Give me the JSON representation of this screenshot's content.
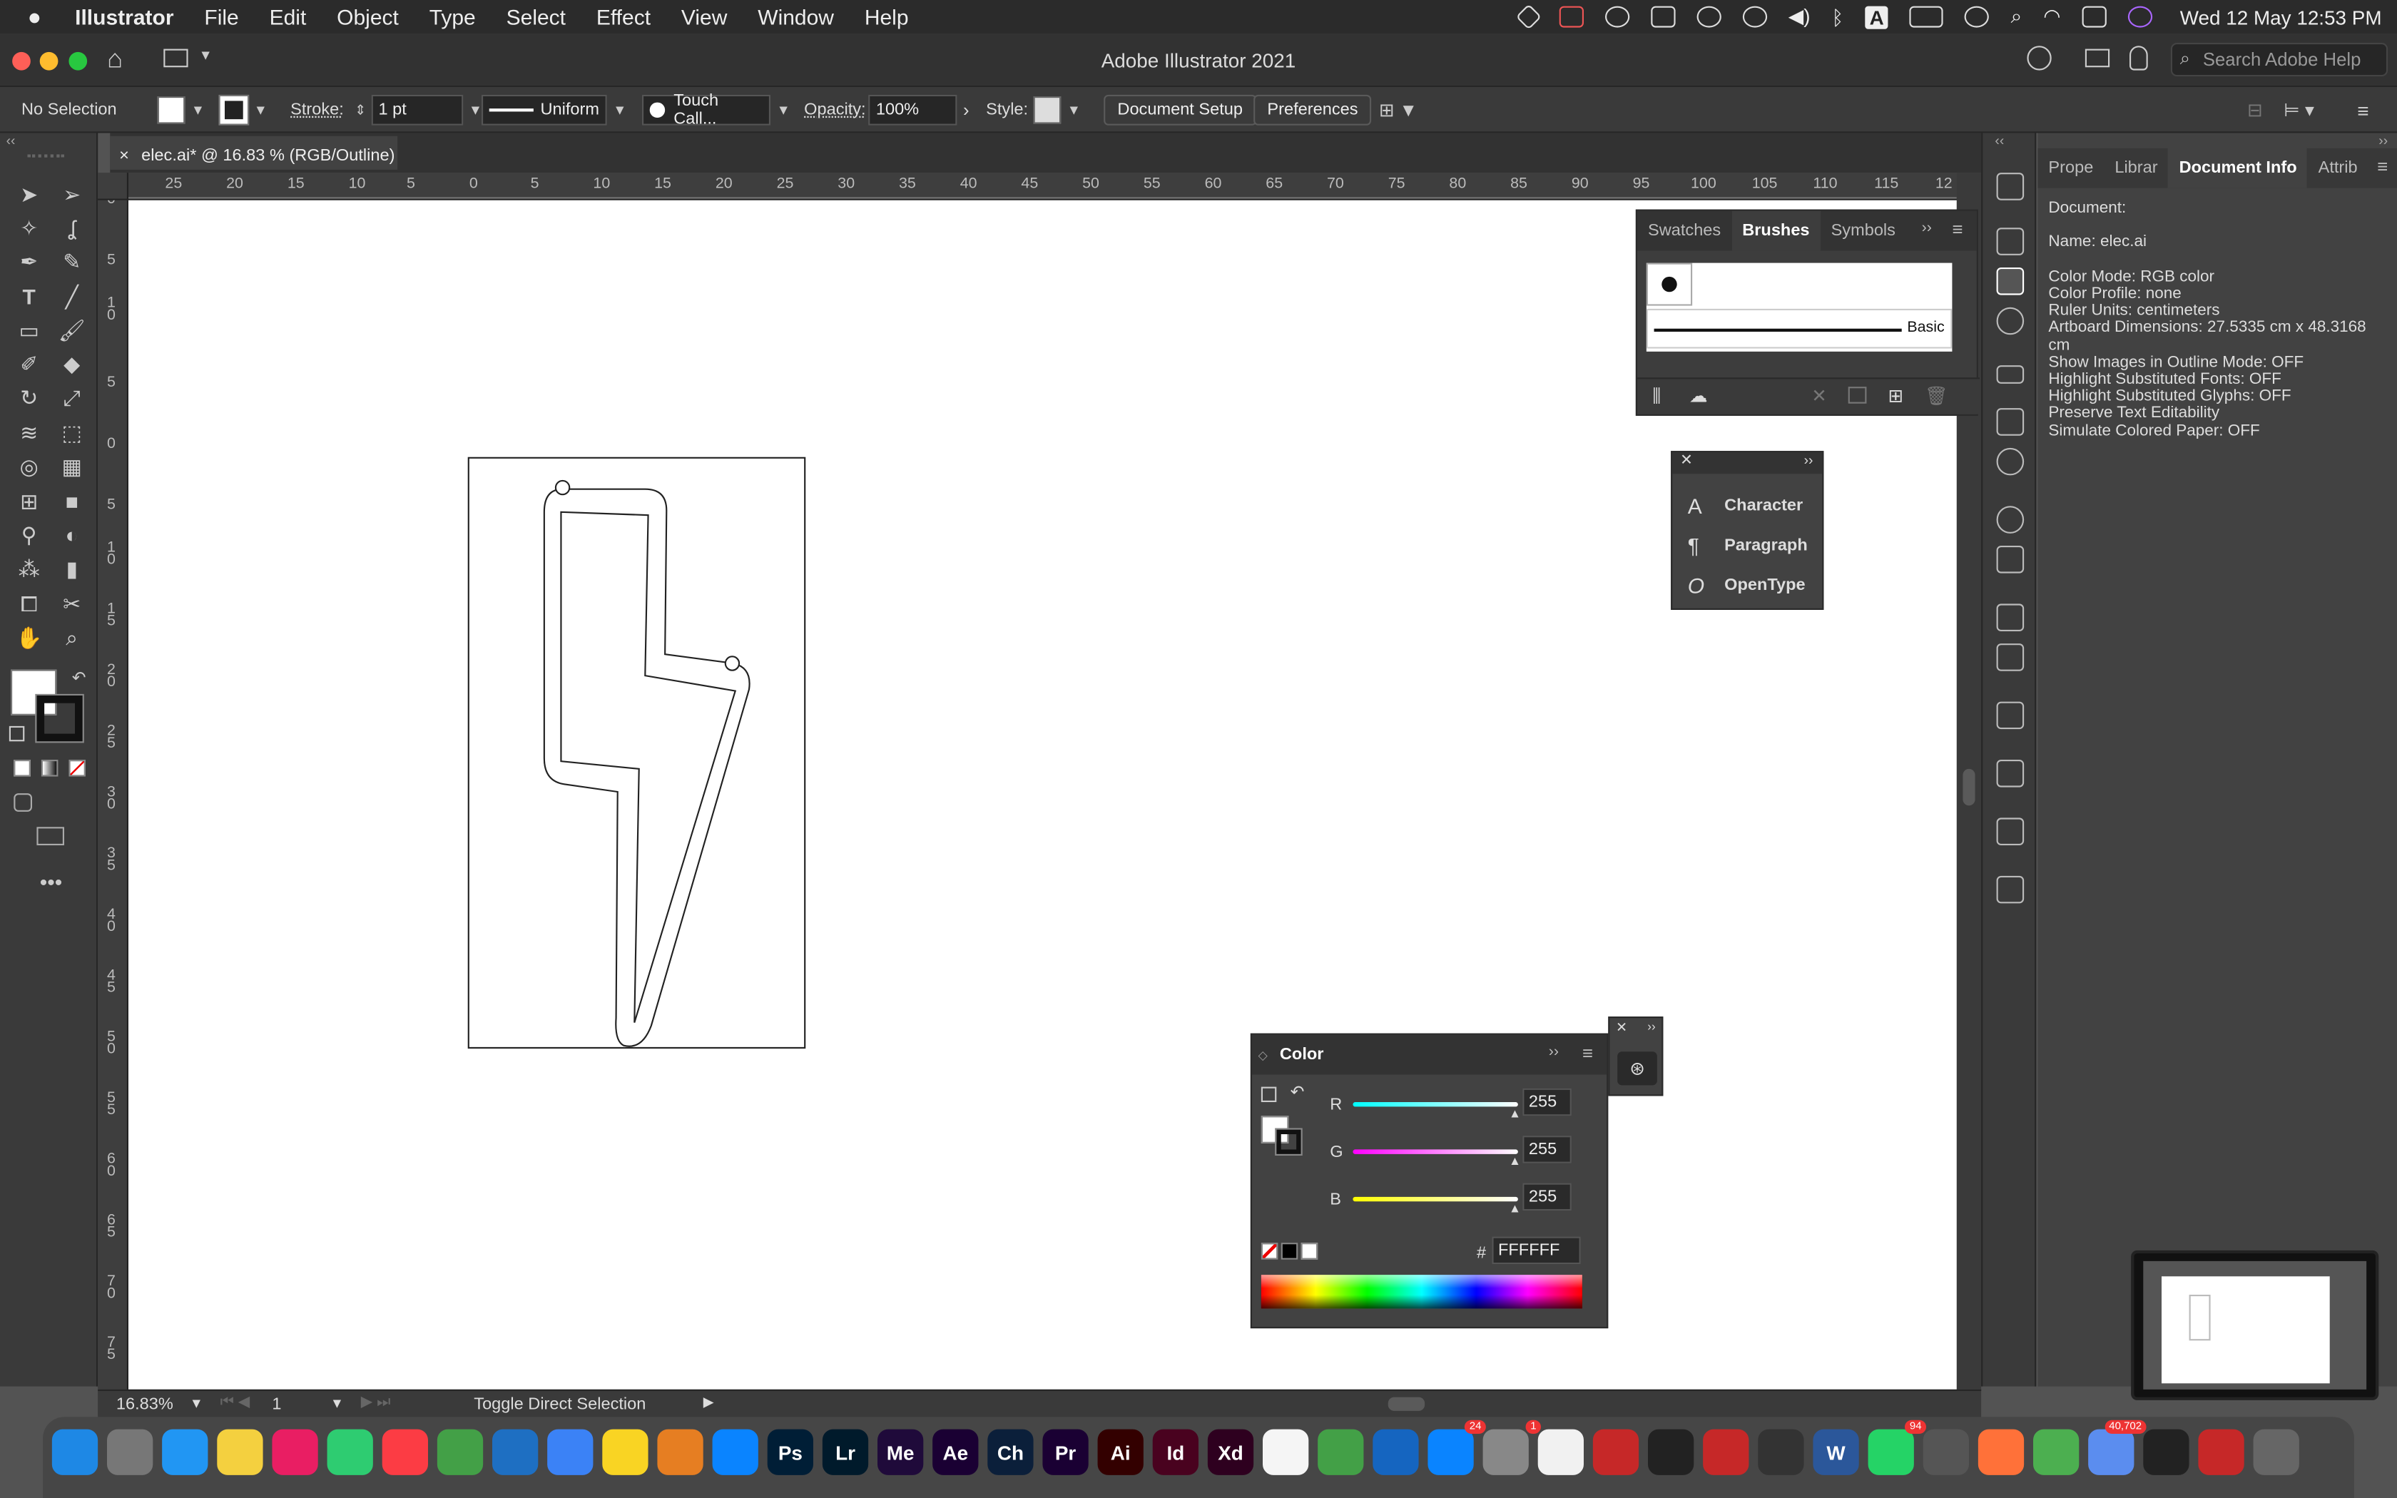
{
  "menubar": {
    "app": "Illustrator",
    "items": [
      "File",
      "Edit",
      "Object",
      "Type",
      "Select",
      "Effect",
      "View",
      "Window",
      "Help"
    ],
    "clock": "Wed 12 May  12:53 PM"
  },
  "titlebar": {
    "title": "Adobe Illustrator 2021",
    "search_placeholder": "Search Adobe Help"
  },
  "control": {
    "selection": "No Selection",
    "stroke_label": "Stroke:",
    "stroke_value": "1 pt",
    "profile": "Uniform",
    "brush": "Touch Call...",
    "opacity_label": "Opacity:",
    "opacity_value": "100%",
    "style_label": "Style:",
    "document_setup": "Document Setup",
    "preferences": "Preferences"
  },
  "doc_tab": {
    "close": "×",
    "label": "elec.ai* @ 16.83 % (RGB/Outline)"
  },
  "ruler_top": [
    "25",
    "20",
    "15",
    "10",
    "5",
    "0",
    "5",
    "10",
    "15",
    "20",
    "25",
    "30",
    "35",
    "40",
    "45",
    "50",
    "55",
    "60",
    "65",
    "70",
    "75",
    "80",
    "85",
    "90",
    "95",
    "100",
    "105",
    "110",
    "115",
    "12"
  ],
  "ruler_left": [
    "0",
    "5",
    "1 0",
    "5",
    "0",
    "5",
    "1 0",
    "1 5",
    "2 0",
    "2 5",
    "3 0",
    "3 5",
    "4 0",
    "4 5",
    "5 0",
    "5 5",
    "6 0",
    "6 5",
    "7 0",
    "7 5"
  ],
  "brushes_panel": {
    "tabs": [
      "Swatches",
      "Brushes",
      "Symbols"
    ],
    "active": "Brushes",
    "basic_label": "Basic"
  },
  "type_panel": {
    "items": [
      {
        "icon": "A",
        "label": "Character"
      },
      {
        "icon": "¶",
        "label": "Paragraph"
      },
      {
        "icon": "O",
        "label": "OpenType"
      }
    ]
  },
  "color_panel": {
    "title": "Color",
    "r_label": "R",
    "r_value": "255",
    "g_label": "G",
    "g_value": "255",
    "b_label": "B",
    "b_value": "255",
    "hex_label": "#",
    "hex_value": "FFFFFF"
  },
  "right_panel": {
    "tabs": [
      "Prope",
      "Librar",
      "Document Info",
      "Attrib"
    ],
    "active": "Document Info",
    "lines": [
      "Document:",
      "",
      "Name: elec.ai",
      "",
      "Color Mode: RGB color",
      "Color Profile: none",
      "Ruler Units: centimeters",
      "Artboard Dimensions: 27.5335 cm x 48.3168",
      "cm",
      "Show Images in Outline Mode: OFF",
      "Highlight Substituted Fonts: OFF",
      "Highlight Substituted Glyphs: OFF",
      "Preserve Text Editability",
      "Simulate Colored Paper: OFF"
    ]
  },
  "status": {
    "zoom": "16.83%",
    "artboard": "1",
    "tool_hint": "Toggle Direct Selection"
  },
  "dock": {
    "apps": [
      {
        "label": "",
        "color": "#1e88e5"
      },
      {
        "label": "",
        "color": "#777"
      },
      {
        "label": "",
        "color": "#2196f3"
      },
      {
        "label": "",
        "color": "#f4d03f"
      },
      {
        "label": "",
        "color": "#e91e63"
      },
      {
        "label": "",
        "color": "#2ecc71"
      },
      {
        "label": "",
        "color": "#fc3c44"
      },
      {
        "label": "",
        "color": "#43a047"
      },
      {
        "label": "",
        "color": "#1e6fc2"
      },
      {
        "label": "",
        "color": "#3b82f6"
      },
      {
        "label": "",
        "color": "#f9d423"
      },
      {
        "label": "",
        "color": "#e67e22"
      },
      {
        "label": "",
        "color": "#0a84ff"
      },
      {
        "label": "Ps",
        "color": "#001e36"
      },
      {
        "label": "Lr",
        "color": "#001a2b"
      },
      {
        "label": "Me",
        "color": "#1f0a3a"
      },
      {
        "label": "Ae",
        "color": "#1a0033"
      },
      {
        "label": "Ch",
        "color": "#0b1f3a"
      },
      {
        "label": "Pr",
        "color": "#1a0033"
      },
      {
        "label": "Ai",
        "color": "#330000"
      },
      {
        "label": "Id",
        "color": "#49021f"
      },
      {
        "label": "Xd",
        "color": "#2e001f"
      },
      {
        "label": "",
        "color": "#f5f5f5"
      },
      {
        "label": "",
        "color": "#43a047"
      },
      {
        "label": "",
        "color": "#1565c0"
      },
      {
        "label": "",
        "color": "#0a84ff",
        "badge": "24"
      },
      {
        "label": "",
        "color": "#888",
        "badge": "1"
      },
      {
        "label": "",
        "color": "#f1f1f1"
      },
      {
        "label": "",
        "color": "#c62828"
      },
      {
        "label": "",
        "color": "#222"
      },
      {
        "label": "",
        "color": "#c62828"
      },
      {
        "label": "",
        "color": "#333"
      },
      {
        "label": "W",
        "color": "#2b579a"
      },
      {
        "label": "",
        "color": "#25d366",
        "badge": "94"
      },
      {
        "label": "",
        "color": "#555"
      },
      {
        "label": "",
        "color": "#ff7139"
      },
      {
        "label": "",
        "color": "#4caf50"
      },
      {
        "label": "",
        "color": "#5b8def",
        "badge": "40,702"
      },
      {
        "label": "",
        "color": "#222"
      },
      {
        "label": "",
        "color": "#c62828"
      },
      {
        "label": "",
        "color": "#666"
      }
    ]
  }
}
